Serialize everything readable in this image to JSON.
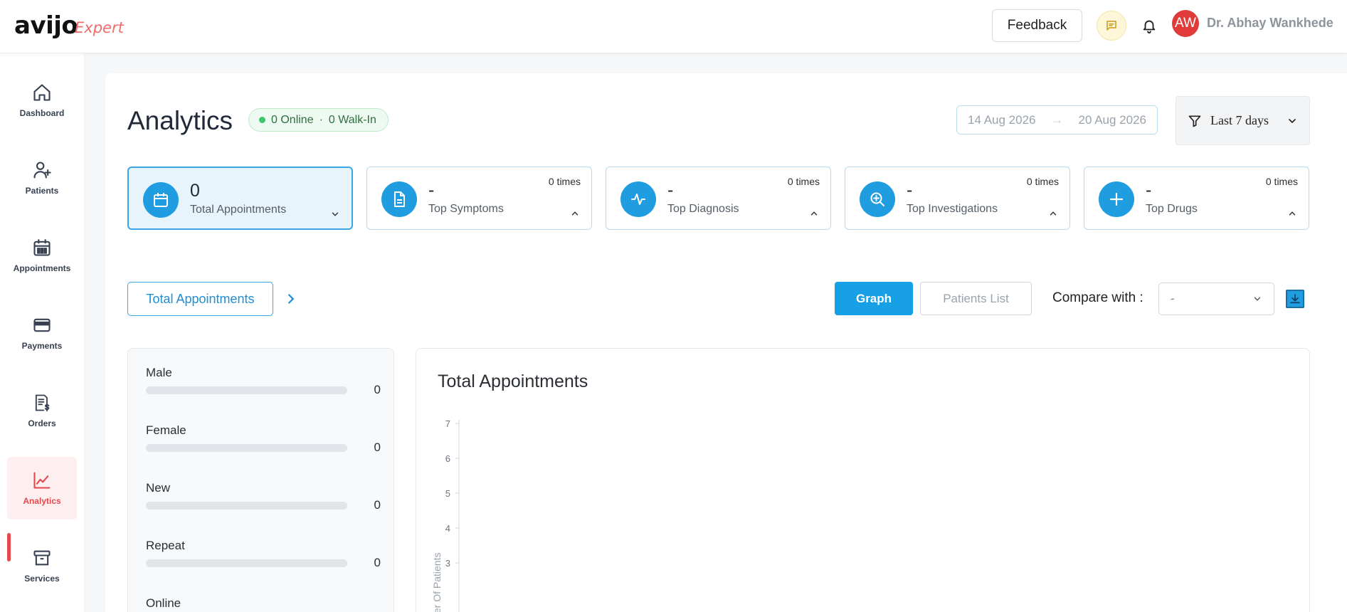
{
  "header": {
    "logo": "avijo",
    "logo_sub": "Expert",
    "feedback_label": "Feedback",
    "avatar_initials": "AW",
    "user_name": "Dr. Abhay Wankhede"
  },
  "sidebar": {
    "items": [
      {
        "label": "Dashboard",
        "icon": "home-icon"
      },
      {
        "label": "Patients",
        "icon": "add-user-icon"
      },
      {
        "label": "Appointments",
        "icon": "calendar-icon"
      },
      {
        "label": "Payments",
        "icon": "credit-card-icon"
      },
      {
        "label": "Orders",
        "icon": "invoice-icon"
      },
      {
        "label": "Analytics",
        "icon": "line-chart-icon",
        "active": true
      },
      {
        "label": "Services",
        "icon": "archive-box-icon"
      }
    ]
  },
  "page": {
    "title": "Analytics",
    "status": {
      "online": "0 Online",
      "separator": "·",
      "walkin": "0 Walk-In"
    },
    "date_from": "14 Aug 2026",
    "date_arrow": "→",
    "date_to": "20 Aug 2026",
    "period": "Last 7 days"
  },
  "cards": [
    {
      "value": "0",
      "label": "Total Appointments",
      "times": "",
      "icon": "calendar-icon",
      "active": true
    },
    {
      "value": "-",
      "label": "Top Symptoms",
      "times": "0 times",
      "icon": "document-icon"
    },
    {
      "value": "-",
      "label": "Top Diagnosis",
      "times": "0 times",
      "icon": "pulse-icon"
    },
    {
      "value": "-",
      "label": "Top Investigations",
      "times": "0 times",
      "icon": "zoom-in-icon"
    },
    {
      "value": "-",
      "label": "Top Drugs",
      "times": "0 times",
      "icon": "plus-icon"
    }
  ],
  "controls": {
    "metric_label": "Total Appointments",
    "graph_label": "Graph",
    "patients_list_label": "Patients List",
    "compare_label": "Compare with :",
    "compare_value": "-"
  },
  "breakdown": [
    {
      "label": "Male",
      "value": "0",
      "fraction": 0
    },
    {
      "label": "Female",
      "value": "0",
      "fraction": 0
    },
    {
      "label": "New",
      "value": "0",
      "fraction": 0
    },
    {
      "label": "Repeat",
      "value": "0",
      "fraction": 0
    },
    {
      "label": "Online",
      "value": "",
      "fraction": 0
    }
  ],
  "chart_data": {
    "type": "line",
    "title": "Total Appointments",
    "xlabel": "",
    "ylabel": "Number Of Patients",
    "ylim": [
      0,
      7
    ],
    "y_ticks": [
      "7",
      "6",
      "5",
      "4",
      "3"
    ],
    "series": []
  },
  "colors": {
    "accent": "#1f9de0",
    "brand": "#e5484d",
    "online_dot": "#3ec46d"
  }
}
